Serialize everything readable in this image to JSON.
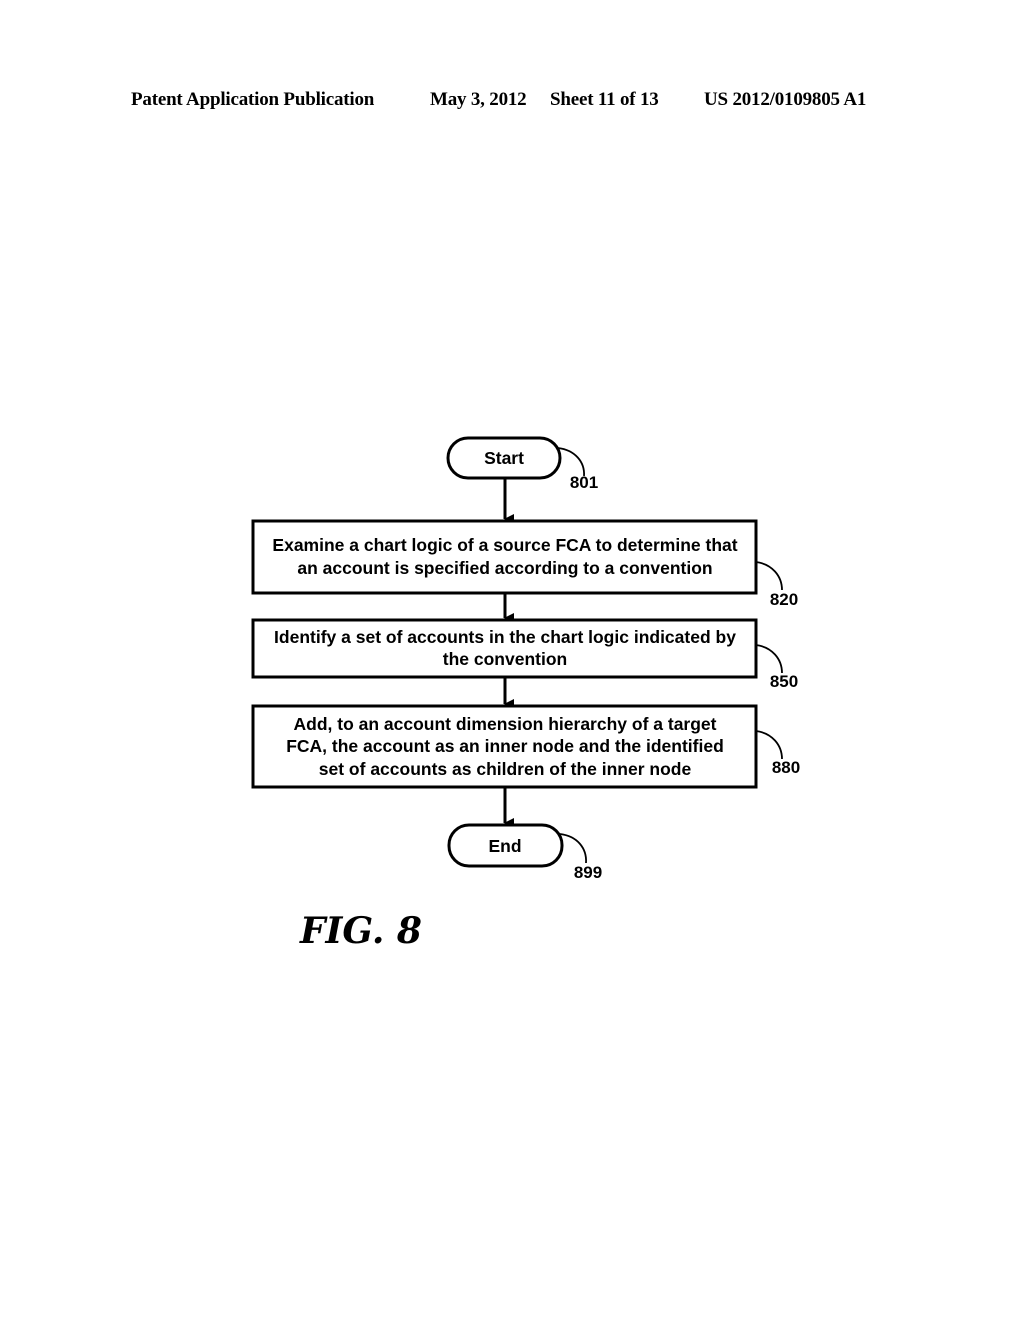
{
  "header": {
    "publication": "Patent Application Publication",
    "date": "May 3, 2012",
    "sheet": "Sheet 11 of 13",
    "number": "US 2012/0109805 A1"
  },
  "flowchart": {
    "start": {
      "label": "Start",
      "ref": "801"
    },
    "steps": [
      {
        "lines": [
          "Examine a chart logic of a source FCA to determine that",
          "an account is specified according to a convention"
        ],
        "ref": "820"
      },
      {
        "lines": [
          "Identify a set of accounts in the chart logic indicated by",
          "the convention"
        ],
        "ref": "850"
      },
      {
        "lines": [
          "Add, to an account dimension hierarchy of a target",
          "FCA, the account as an inner node and the identified",
          "set of accounts as children of the inner node"
        ],
        "ref": "880"
      }
    ],
    "end": {
      "label": "End",
      "ref": "899"
    }
  },
  "figure_label": "FIG. 8"
}
